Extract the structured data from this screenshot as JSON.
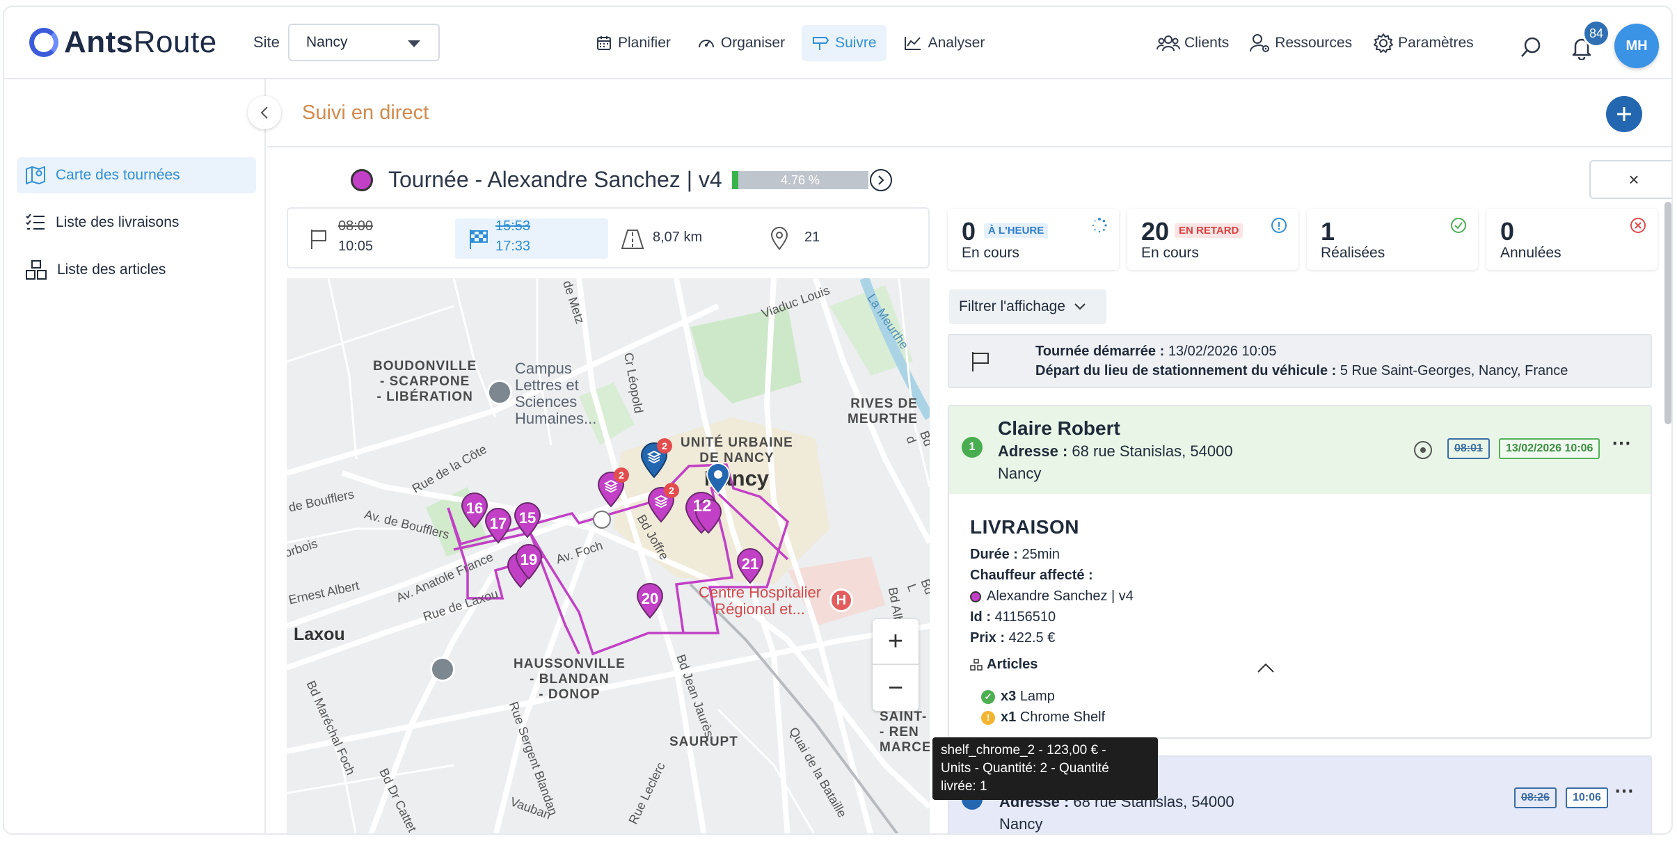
{
  "header": {
    "logo_brand_bold": "Ants",
    "logo_brand_light": "Route",
    "site_label": "Site",
    "site_value": "Nancy",
    "nav": [
      {
        "label": "Planifier"
      },
      {
        "label": "Organiser"
      },
      {
        "label": "Suivre"
      },
      {
        "label": "Analyser"
      }
    ],
    "right_nav": [
      {
        "label": "Clients"
      },
      {
        "label": "Ressources"
      },
      {
        "label": "Paramètres"
      }
    ],
    "notification_count": "84",
    "avatar_initials": "MH"
  },
  "sidebar": {
    "items": [
      {
        "label": "Carte des tournées"
      },
      {
        "label": "Liste des livraisons"
      },
      {
        "label": "Liste des articles"
      }
    ]
  },
  "page": {
    "title": "Suivi en direct",
    "tour_title": "Tournée - Alexandre Sanchez | v4",
    "tour_color": "#c240c6",
    "progress_text": "4.76 %",
    "progress_value": 4.76,
    "close_symbol": "×"
  },
  "infobar": {
    "start_planned": "08:00",
    "start_actual": "10:05",
    "end_planned": "15:53",
    "end_actual": "17:33",
    "distance": "8,07 km",
    "stops": "21"
  },
  "map": {
    "labels": {
      "boudonville": "BOUDONVILLE",
      "scarpone": "- SCARPONE",
      "liberation": "- LIBÉRATION",
      "campus1": "Campus",
      "campus2": "Lettres et",
      "campus3": "Sciences",
      "campus4": "Humaines...",
      "unite1": "UNITÉ URBAINE",
      "unite2": "DE NANCY",
      "nancy": "Nancy",
      "rives1": "RIVES DE",
      "rives2": "MEURTHE",
      "laxou": "Laxou",
      "hauss1": "HAUSSONVILLE",
      "hauss2": "- BLANDAN",
      "hauss3": "- DONOP",
      "saurupt": "SAURUPT",
      "saint1": "SAINT-",
      "saint2": "- REN",
      "saint3": "MARCE",
      "hopital1": "Centre Hospitalier",
      "hopital2": "Régional et...",
      "rue_cote": "Rue de la Côte",
      "av_boufflers": "Av. de Boufflers",
      "de_boufflers": "de Boufflers",
      "av_anatole": "Av. Anatole France",
      "rue_laxou": "Rue de Laxou",
      "ernest": "Ernest Albert",
      "av_foch": "Av. Foch",
      "bd_joffre": "Bd Joffre",
      "cr_leopold": "Cr Léopold",
      "viaduc": "Viaduc Louis",
      "la_meurthe": "La Meurthe",
      "bd_marechal": "Bd Maréchal Foch",
      "rue_sergent": "Rue Sergent Blandan",
      "bd_jean": "Bd Jean Jaurès",
      "rue_leclerc": "Rue Leclerc",
      "vauban": "Vauban",
      "bd_cattet": "Bd Dr Cattet",
      "quai": "Quai de la Bataille",
      "bd_albert": "Bd Albert",
      "rue_metz": "de Metz",
      "orbois": "orbois",
      "bd_d": "Bd d",
      "bd_l": "Bd L"
    },
    "markers": [
      "16",
      "17",
      "15",
      "19",
      "20",
      "21",
      "12",
      "2",
      "2",
      "2"
    ],
    "zoom_in": "+",
    "zoom_out": "−"
  },
  "stats": [
    {
      "count": "0",
      "tag": "À L'HEURE",
      "label": "En cours"
    },
    {
      "count": "20",
      "tag": "EN RETARD",
      "label": "En cours"
    },
    {
      "count": "1",
      "tag": "",
      "label": "Réalisées"
    },
    {
      "count": "0",
      "tag": "",
      "label": "Annulées"
    }
  ],
  "filter": {
    "label": "Filtrer l'affichage"
  },
  "start_info": {
    "line1_label": "Tournée démarrée :",
    "line1_value": "13/02/2026 10:05",
    "line2_label": "Départ du lieu de stationnement du véhicule :",
    "line2_value": "5 Rue Saint-Georges, Nancy, France"
  },
  "stop1": {
    "index": "1",
    "name": "Claire Robert",
    "address_label": "Adresse :",
    "address_line1": "68 rue Stanislas, 54000",
    "address_line2": "Nancy",
    "time_planned": "08:01",
    "time_actual": "13/02/2026 10:06",
    "section_title": "LIVRAISON",
    "duration_label": "Durée :",
    "duration_value": "25min",
    "driver_label": "Chauffeur affecté :",
    "driver_value": "Alexandre Sanchez | v4",
    "id_label": "Id :",
    "id_value": "41156510",
    "price_label": "Prix :",
    "price_value": "422.5 €",
    "articles_label": "Articles",
    "articles": [
      {
        "qty": "x3",
        "name": "Lamp",
        "status_color": "#4caf50"
      },
      {
        "qty": "x1",
        "name": "Chrome Shelf",
        "status_color": "#f3b531"
      }
    ]
  },
  "stop2": {
    "address_label": "Adresse :",
    "address_line1": "68 rue Stanislas, 54000",
    "address_line2": "Nancy",
    "time_planned": "08:26",
    "time_actual": "10:06"
  },
  "tooltip": {
    "line1": "shelf_chrome_2 - 123,00 € -",
    "line2": "Units - Quantité: 2 - Quantité",
    "line3": "livrée: 1"
  },
  "colors": {
    "accent": "#2f8fd6",
    "title_orange": "#d28a4b",
    "route": "#c240c6",
    "primary_button": "#2467b1"
  }
}
